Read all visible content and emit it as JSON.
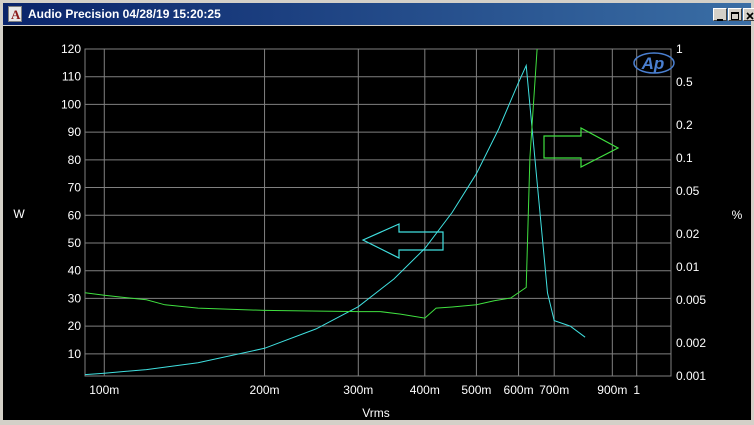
{
  "window": {
    "title": "Audio Precision  04/28/19 15:20:25",
    "app_icon": "audio-precision-icon",
    "minimize_icon": "minimize-icon",
    "maximize_icon": "maximize-icon",
    "close_icon": "close-icon"
  },
  "colors": {
    "background": "#000000",
    "grid": "#808080",
    "text": "#ffffff",
    "power_curve": "#40e0e0",
    "thdn_curve": "#40e040",
    "titlebar": "#0a246a"
  },
  "chart_data": {
    "type": "line",
    "logo": "Ap",
    "xlabel": "Vrms",
    "ylabel_left": "W",
    "ylabel_right": "%",
    "x_scale": "log",
    "xlim": [
      0.092,
      1.16
    ],
    "ylim_left": [
      2,
      120
    ],
    "ylim_right": [
      0.001,
      1
    ],
    "y_right_scale": "log",
    "grid": true,
    "x_ticks": [
      {
        "value": 0.1,
        "label": "100m"
      },
      {
        "value": 0.2,
        "label": "200m"
      },
      {
        "value": 0.3,
        "label": "300m"
      },
      {
        "value": 0.4,
        "label": "400m"
      },
      {
        "value": 0.5,
        "label": "500m"
      },
      {
        "value": 0.6,
        "label": "600m"
      },
      {
        "value": 0.7,
        "label": "700m"
      },
      {
        "value": 0.9,
        "label": "900m"
      },
      {
        "value": 1.0,
        "label": "1"
      }
    ],
    "y_left_ticks": [
      {
        "value": 10,
        "label": "10"
      },
      {
        "value": 20,
        "label": "20"
      },
      {
        "value": 30,
        "label": "30"
      },
      {
        "value": 40,
        "label": "40"
      },
      {
        "value": 50,
        "label": "50"
      },
      {
        "value": 60,
        "label": "60"
      },
      {
        "value": 70,
        "label": "70"
      },
      {
        "value": 80,
        "label": "80"
      },
      {
        "value": 90,
        "label": "90"
      },
      {
        "value": 100,
        "label": "100"
      },
      {
        "value": 110,
        "label": "110"
      },
      {
        "value": 120,
        "label": "120"
      }
    ],
    "y_right_ticks": [
      {
        "value": 1,
        "label": "1"
      },
      {
        "value": 0.5,
        "label": "0.5"
      },
      {
        "value": 0.2,
        "label": "0.2"
      },
      {
        "value": 0.1,
        "label": "0.1"
      },
      {
        "value": 0.05,
        "label": "0.05"
      },
      {
        "value": 0.02,
        "label": "0.02"
      },
      {
        "value": 0.01,
        "label": "0.01"
      },
      {
        "value": 0.005,
        "label": "0.005"
      },
      {
        "value": 0.002,
        "label": "0.002"
      },
      {
        "value": 0.001,
        "label": "0.001"
      }
    ],
    "series": [
      {
        "axis": "left",
        "color": "#40e0e0",
        "x": [
          0.092,
          0.1,
          0.12,
          0.15,
          0.2,
          0.25,
          0.3,
          0.35,
          0.4,
          0.45,
          0.5,
          0.55,
          0.6,
          0.62,
          0.65,
          0.68,
          0.7,
          0.75,
          0.8
        ],
        "y": [
          2.5,
          3,
          4.3,
          6.8,
          12,
          19,
          27,
          37,
          48,
          61,
          75,
          91,
          108,
          114,
          72,
          32,
          22,
          20,
          16
        ]
      },
      {
        "axis": "right",
        "color": "#40e040",
        "x": [
          0.092,
          0.1,
          0.12,
          0.13,
          0.15,
          0.2,
          0.3,
          0.33,
          0.36,
          0.4,
          0.42,
          0.45,
          0.5,
          0.54,
          0.58,
          0.62,
          0.63,
          0.65
        ],
        "y": [
          0.0058,
          0.0055,
          0.005,
          0.0045,
          0.0042,
          0.004,
          0.0039,
          0.0039,
          0.0037,
          0.0034,
          0.0042,
          0.0043,
          0.0045,
          0.0049,
          0.0052,
          0.0065,
          0.1,
          1.0
        ]
      }
    ],
    "annotations": [
      {
        "type": "arrow",
        "direction": "left",
        "color": "#40e0e0",
        "points_to": "left axis"
      },
      {
        "type": "arrow",
        "direction": "right",
        "color": "#40e040",
        "points_to": "right axis"
      }
    ]
  }
}
